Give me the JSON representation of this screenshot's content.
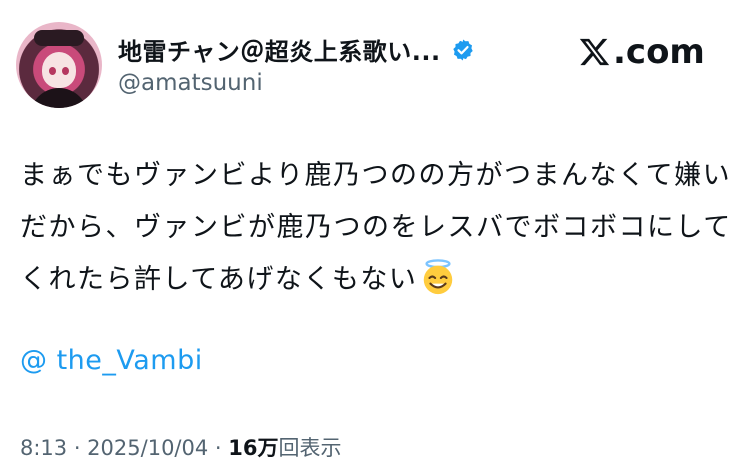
{
  "author": {
    "display_name": "地雷チャン＠超炎上系歌い...",
    "handle": "@amatsuuni",
    "verified_badge_color": "#1d9bf0"
  },
  "brand": {
    "label": ".com",
    "icon": "x-logo-icon"
  },
  "tweet": {
    "text": "まぁでもヴァンビより鹿乃つのの方がつまんなくて嫌いだから、ヴァンビが鹿乃つのをレスバでボコボコにしてくれたら許してあげなくもない",
    "emoji": "smiling-face-with-halo",
    "mention": "@ the_Vambi"
  },
  "meta": {
    "datetime": "8:13 · 2025/10/04 · ",
    "views_count": "16万",
    "views_label": "回表示"
  },
  "colors": {
    "link": "#1d9bf0",
    "secondary_text": "#536471",
    "primary_text": "#0f1419"
  }
}
